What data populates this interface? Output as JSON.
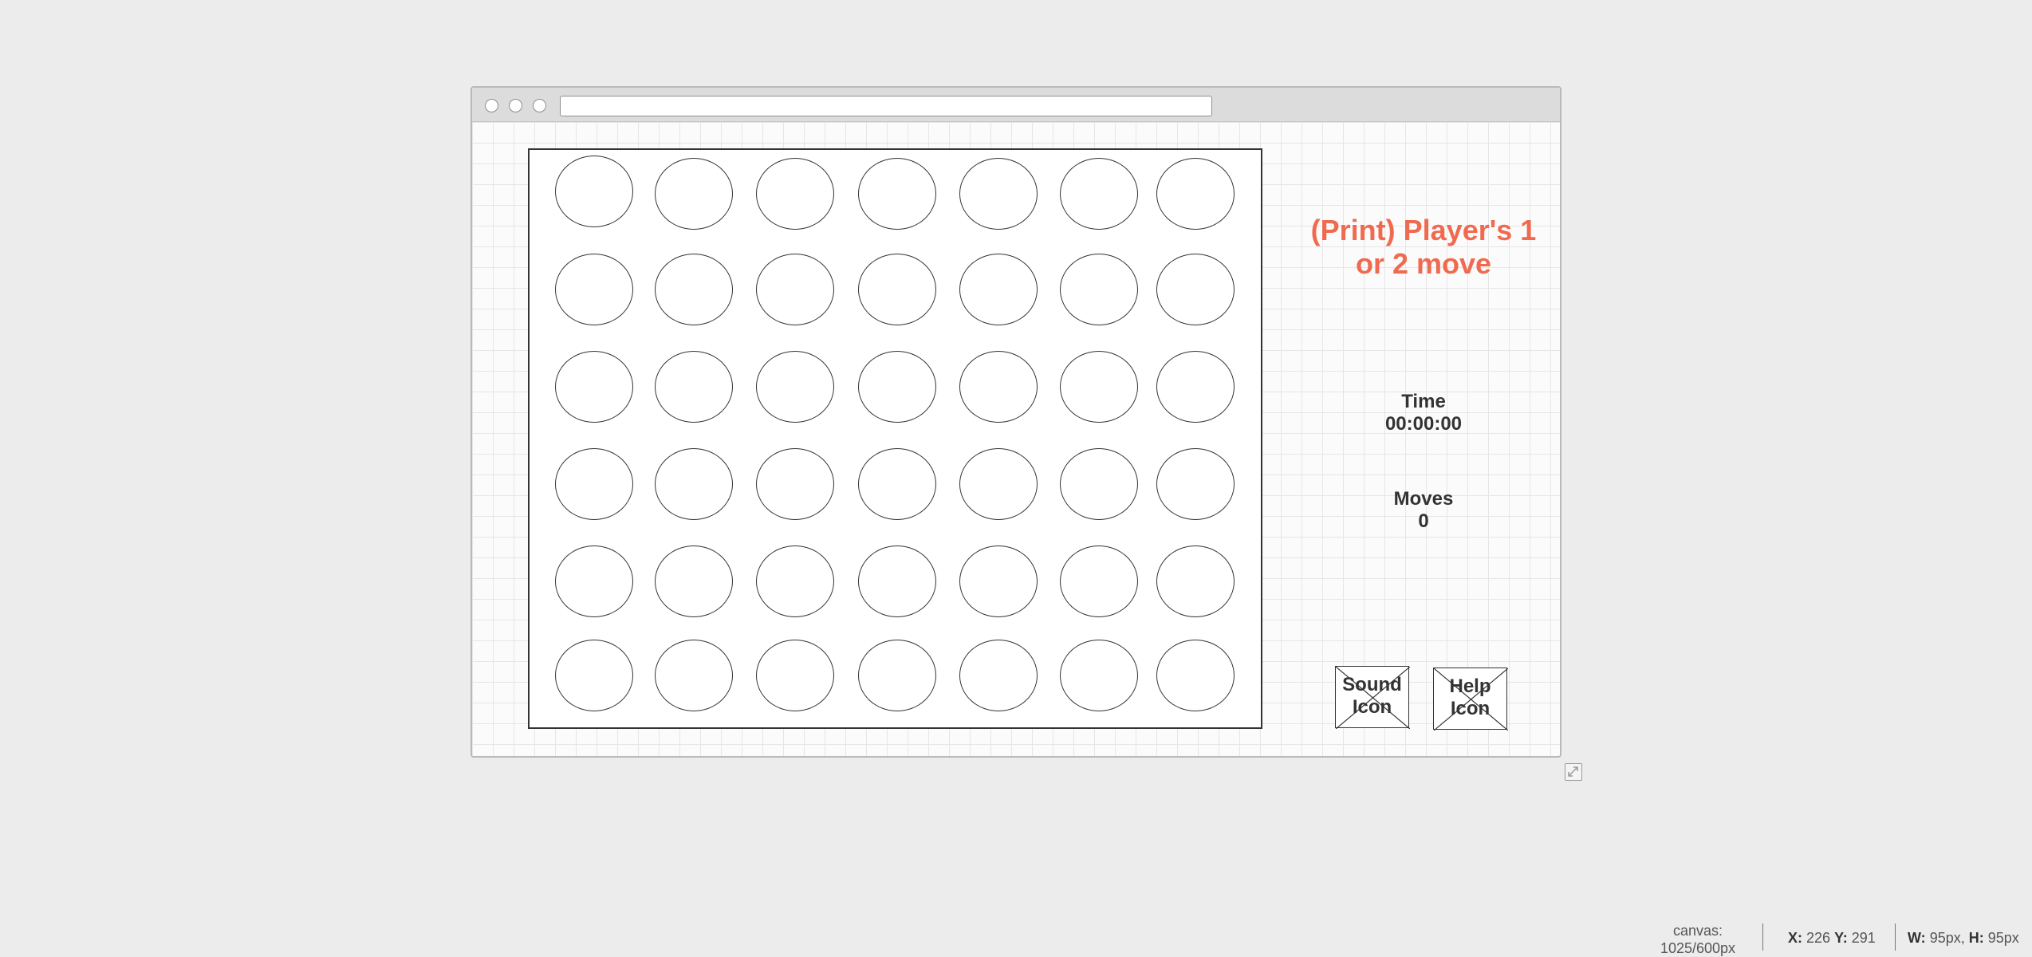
{
  "game": {
    "player_message": "(Print) Player's 1 or 2 move",
    "time_label": "Time",
    "time_value": "00:00:00",
    "moves_label": "Moves",
    "moves_value": "0"
  },
  "board": {
    "columns": 7,
    "rows": 6
  },
  "icons": {
    "sound_label": "Sound Icon",
    "help_label": "Help Icon"
  },
  "status_bar": {
    "canvas_label": "canvas:",
    "canvas_size": "1025/600px",
    "x_label": "X:",
    "x_value": "226",
    "y_label": "Y:",
    "y_value": "291",
    "w_label": "W:",
    "w_value": "95px,",
    "h_label": "H:",
    "h_value": "95px"
  },
  "colors": {
    "accent": "#f06a4f",
    "grid": "#e6e6e6",
    "ink": "#333333"
  }
}
